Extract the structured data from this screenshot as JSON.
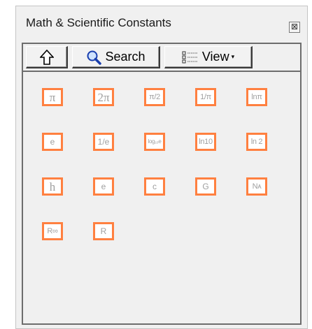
{
  "window": {
    "title": "Math & Scientific Constants",
    "close_glyph": "⊠"
  },
  "toolbar": {
    "search_label": "Search",
    "view_label": "View",
    "view_caret": "▾"
  },
  "constants": [
    {
      "label": "π",
      "style": "serif"
    },
    {
      "label": "2π",
      "style": "serif"
    },
    {
      "label": "π/2",
      "style": "med"
    },
    {
      "label": "1/π",
      "style": "med"
    },
    {
      "label": "lnπ",
      "style": "med"
    },
    {
      "label": "e",
      "style": ""
    },
    {
      "label": "1/e",
      "style": ""
    },
    {
      "label": "log₁₀e",
      "style": "small"
    },
    {
      "label": "ln10",
      "style": "med"
    },
    {
      "label": "ln 2",
      "style": "med"
    },
    {
      "label": "h",
      "style": "serif"
    },
    {
      "label": "e",
      "style": ""
    },
    {
      "label": "c",
      "style": ""
    },
    {
      "label": "G",
      "style": ""
    },
    {
      "label": "Nᴀ",
      "style": "med"
    },
    {
      "label": "R∞",
      "style": "med"
    },
    {
      "label": "R",
      "style": ""
    }
  ],
  "colors": {
    "item_border": "#ff8040",
    "item_text": "#a0a0a0",
    "panel_bg": "#f0f0f0"
  }
}
